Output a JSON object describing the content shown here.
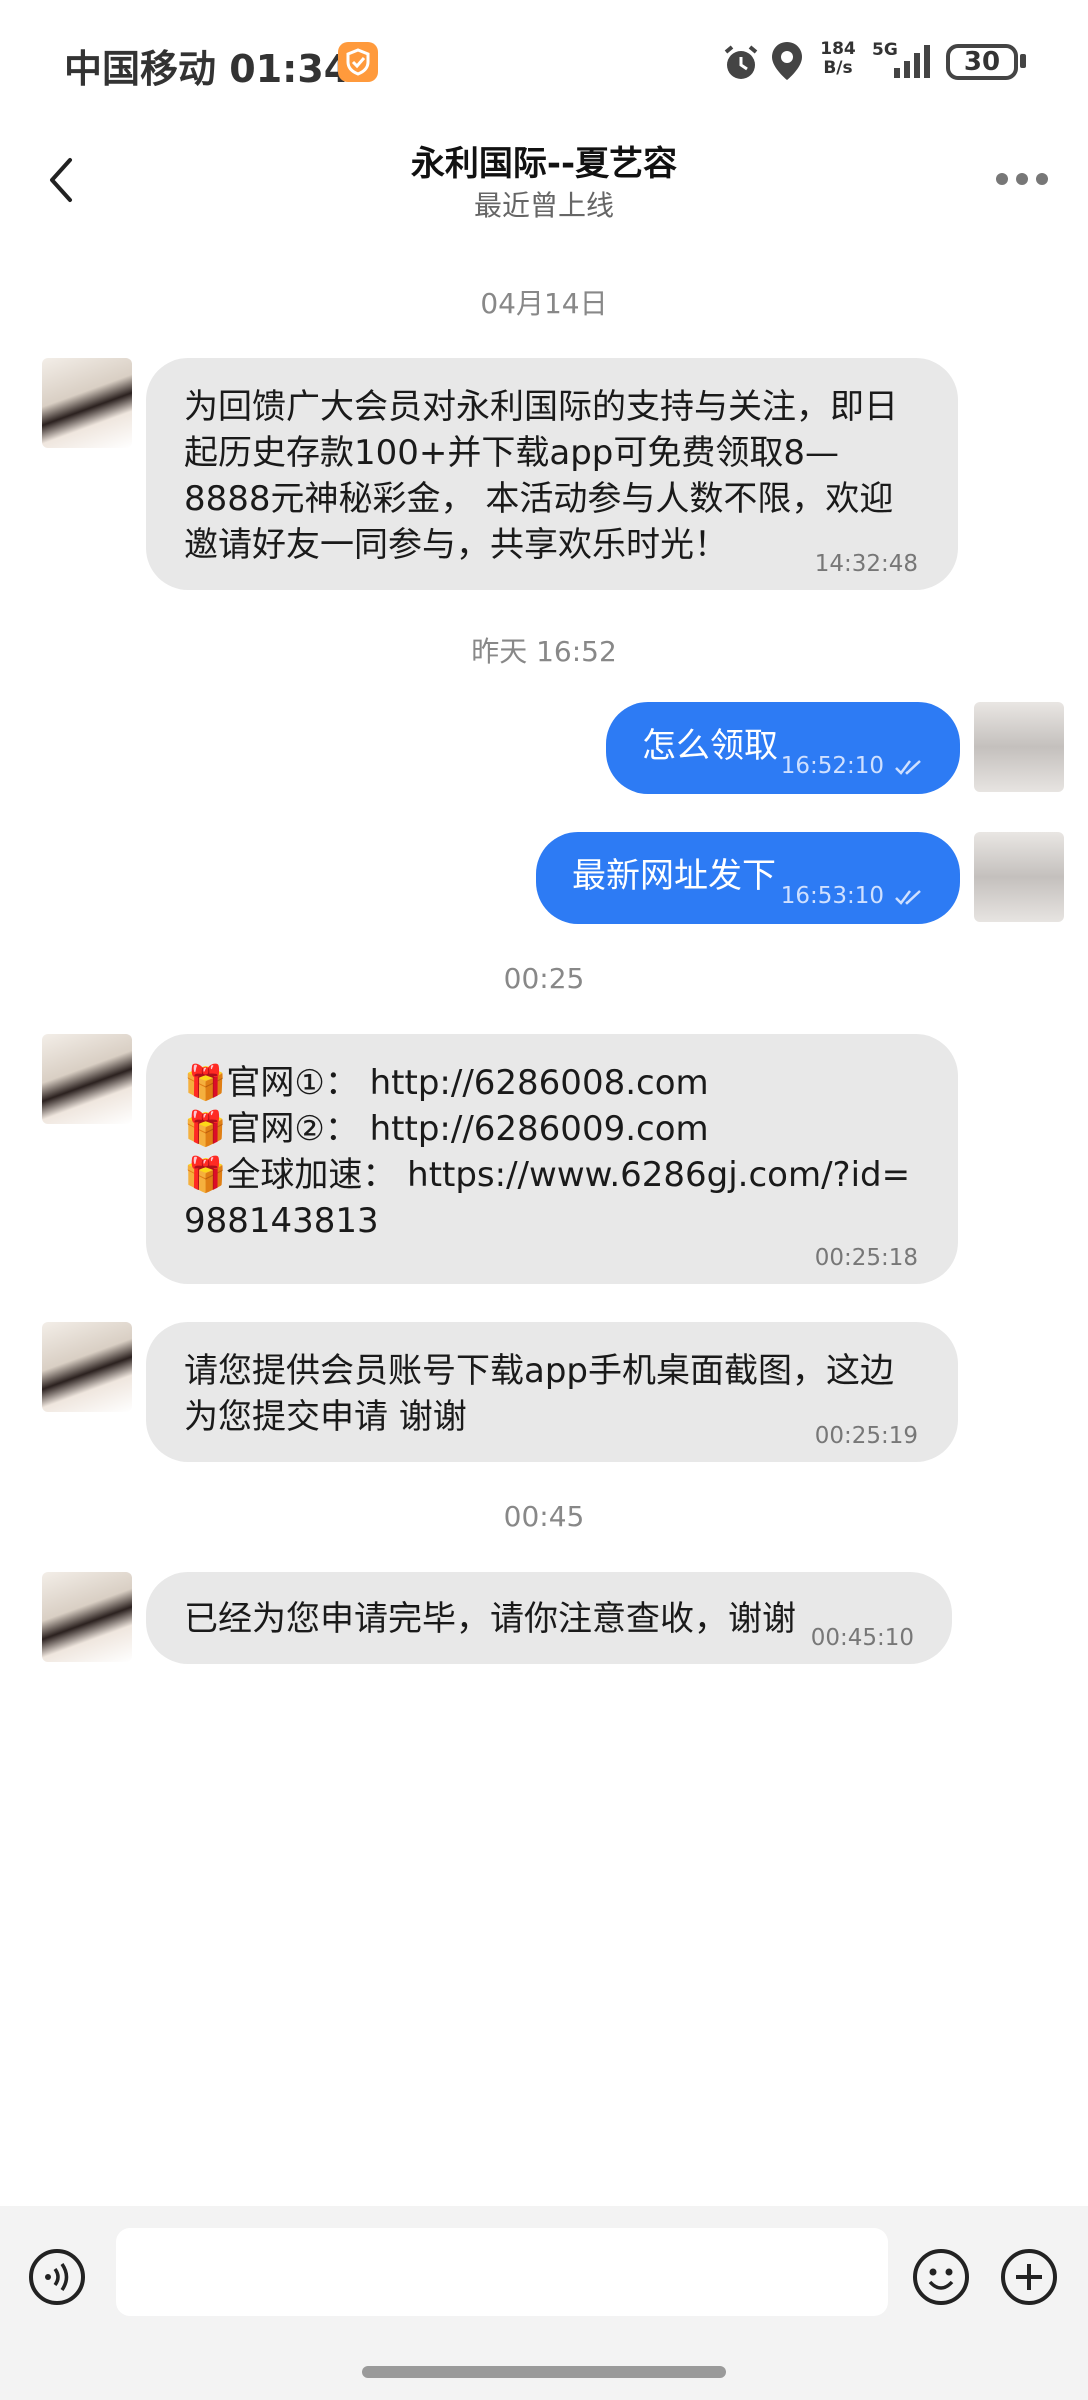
{
  "status_bar": {
    "carrier": "中国移动",
    "time": "01:34",
    "net_speed_value": "184",
    "net_speed_unit": "B/s",
    "network": "5G",
    "battery": "30"
  },
  "header": {
    "title": "永利国际--夏艺容",
    "subtitle": "最近曾上线"
  },
  "messages": {
    "ts1": "04月14日",
    "m1_text": "为回馈广大会员对永利国际的支持与关注，即日起历史存款100+并下载app可免费领取8—8888元神秘彩金， 本活动参与人数不限，欢迎邀请好友一同参与，共享欢乐时光！",
    "m1_time": "14:32:48",
    "ts2": "昨天 16:52",
    "m2_text": "怎么领取",
    "m2_time": "16:52:10",
    "m3_text": "最新网址发下",
    "m3_time": "16:53:10",
    "ts3": "00:25",
    "m4_line1": "🎁官网①： http://6286008.com",
    "m4_line2": "🎁官网②： http://6286009.com",
    "m4_line3": "🎁全球加速： https://www.6286gj.com/?id=988143813",
    "m4_time": "00:25:18",
    "m5_text": "请您提供会员账号下载app手机桌面截图，这边为您提交申请 谢谢",
    "m5_time": "00:25:19",
    "ts4": "00:45",
    "m6_text": "已经为您申请完毕，请你注意查收，谢谢",
    "m6_time": "00:45:10"
  },
  "input": {
    "placeholder": ""
  },
  "colors": {
    "outgoing_bubble": "#2d7bf4",
    "incoming_bubble": "#e8e8e8"
  }
}
